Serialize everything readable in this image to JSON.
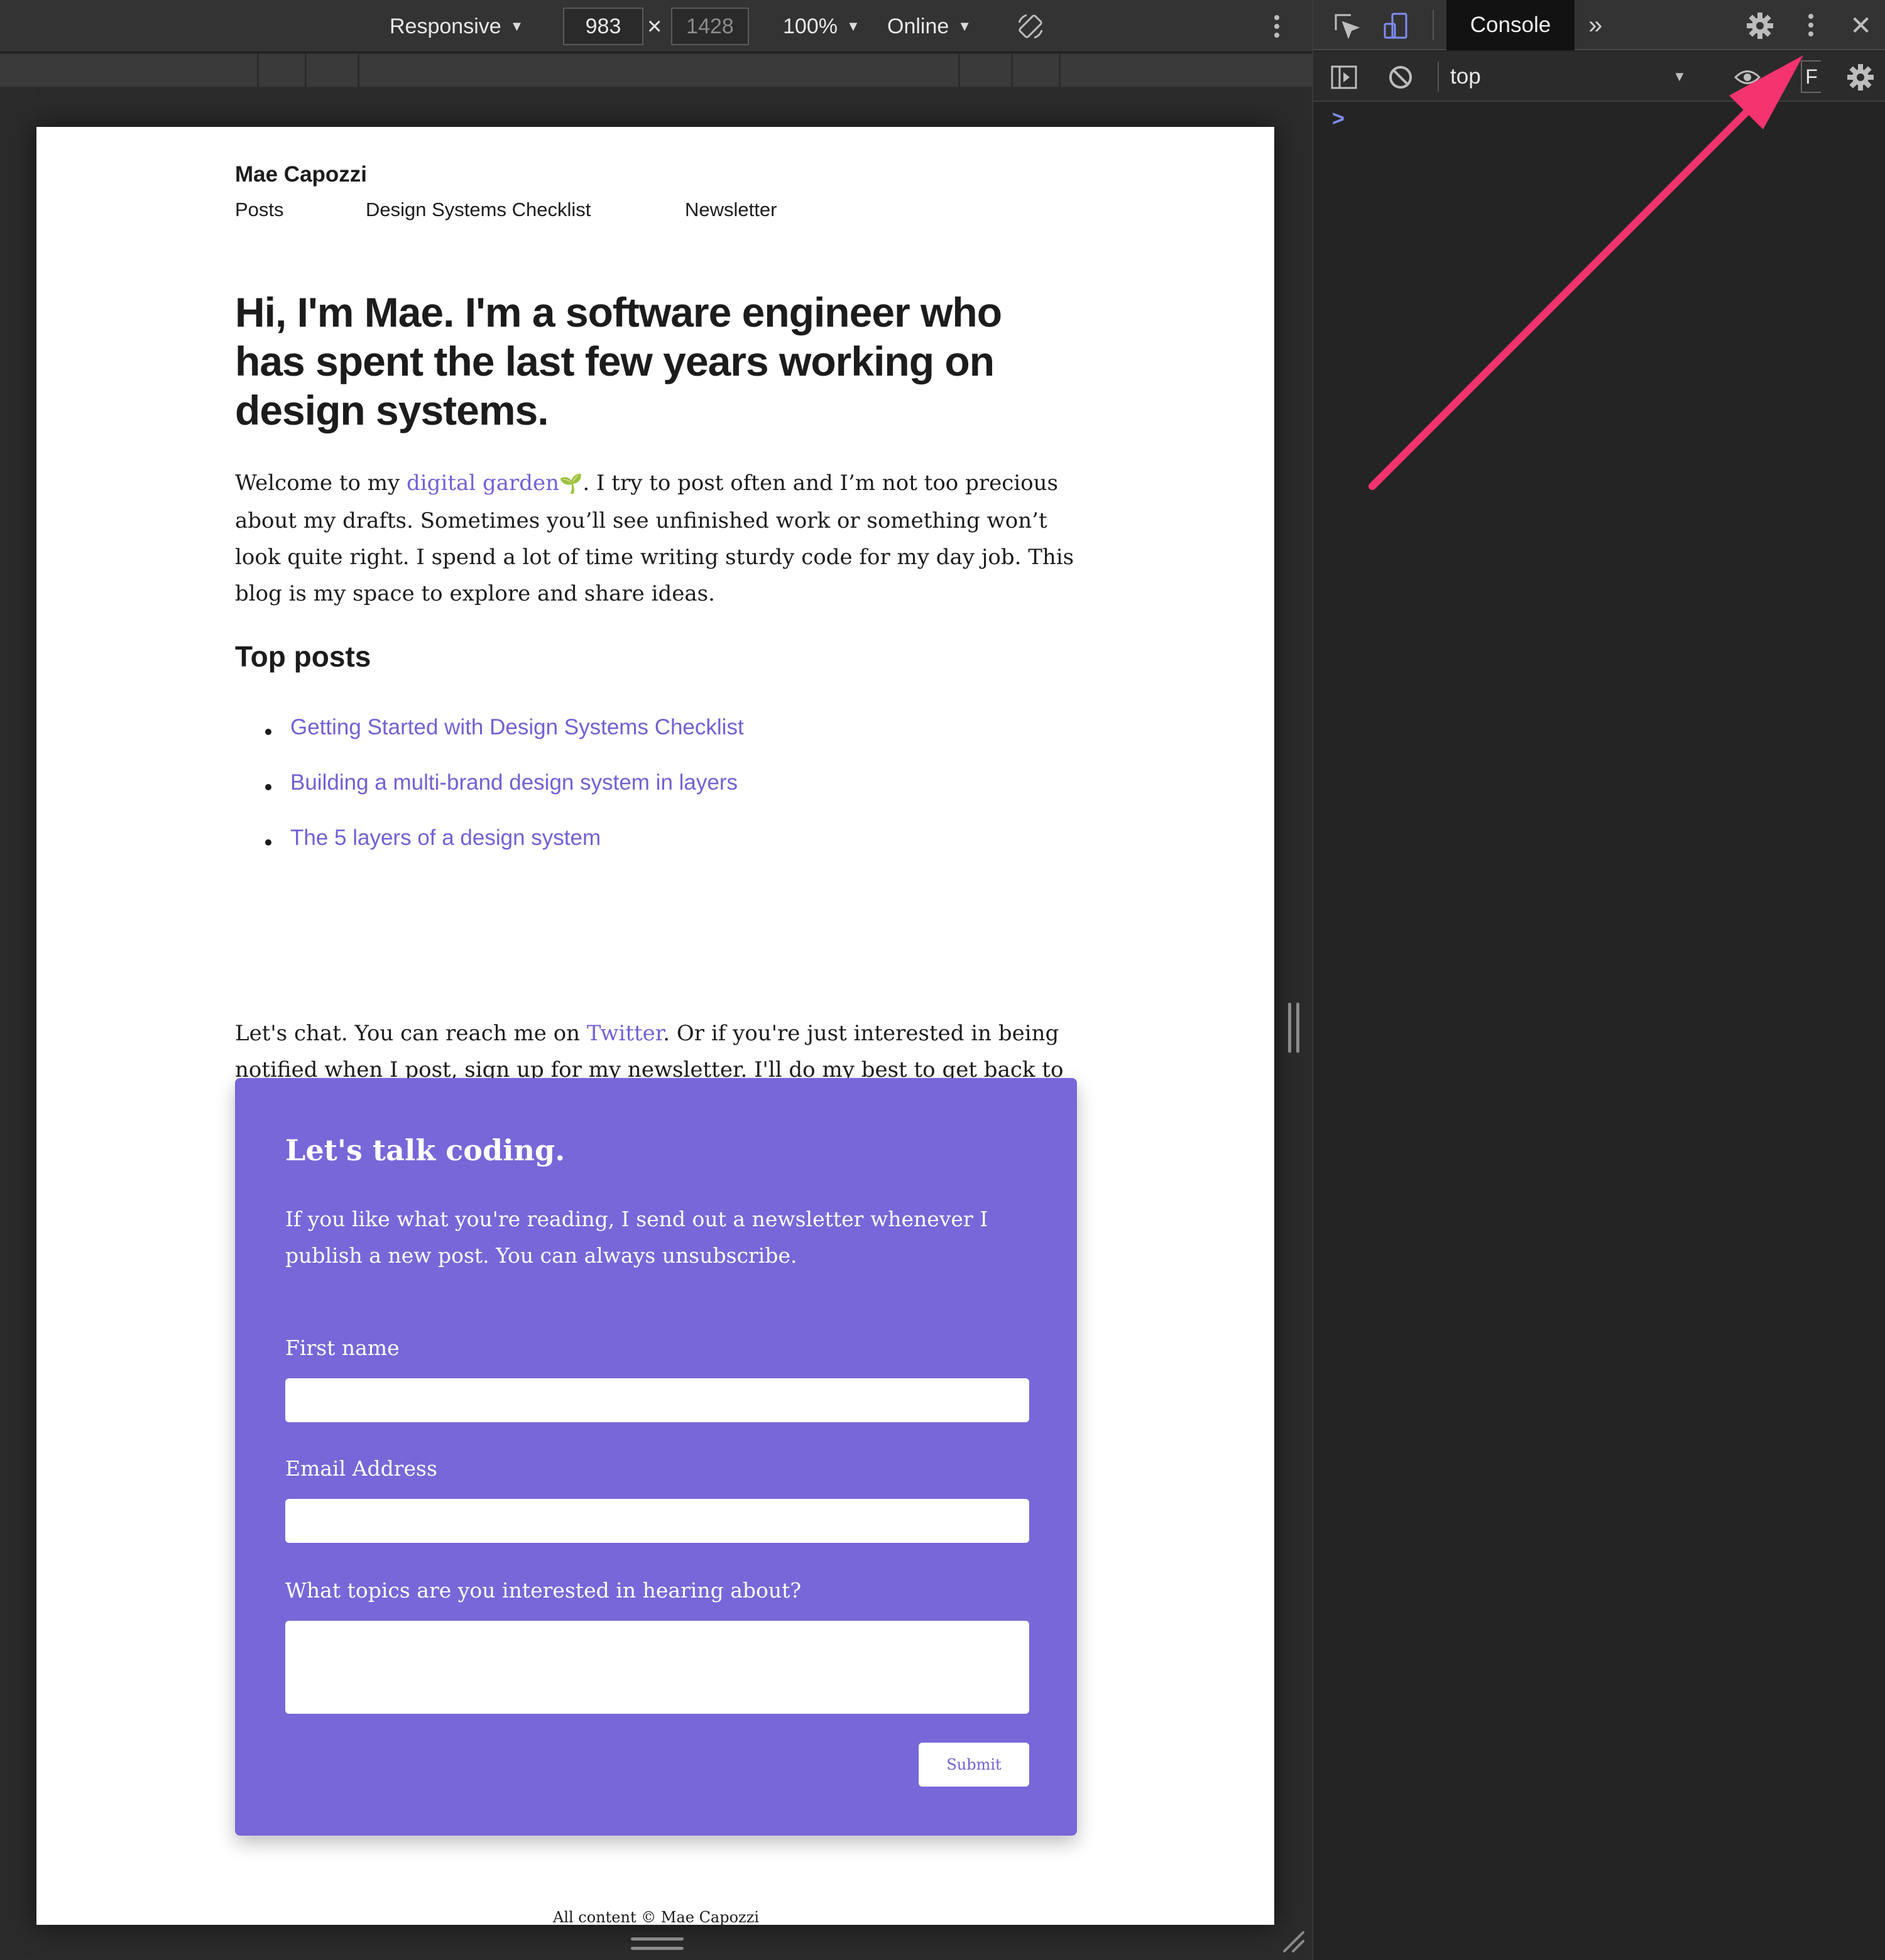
{
  "device_toolbar": {
    "mode": "Responsive",
    "width": "983",
    "height": "1428",
    "zoom": "100%",
    "throttling": "Online",
    "caret": "▼",
    "times": "×"
  },
  "site": {
    "name": "Mae Capozzi",
    "nav": [
      "Posts",
      "Design Systems Checklist",
      "Newsletter"
    ]
  },
  "hero": {
    "heading": "Hi, I'm Mae. I'm a software engineer who has spent the last few years working on design systems."
  },
  "intro": {
    "before": "Welcome to my ",
    "link": "digital garden",
    "sprout": "🌱",
    "after": ". I try to post often and I’m not too precious about my drafts. Sometimes you’ll see unfinished work or something won’t look quite right. I spend a lot of time writing sturdy code for my day job. This blog is my space to explore and share ideas."
  },
  "top_posts": {
    "title": "Top posts",
    "items": [
      "Getting Started with Design Systems Checklist",
      "Building a multi-brand design system in layers",
      "The 5 layers of a design system"
    ]
  },
  "chat": {
    "before": "Let's chat. You can reach me on ",
    "link": "Twitter",
    "after": ". Or if you're just interested in being notified when I post, sign up for my newsletter. I'll do my best to get back to you as soon as I can."
  },
  "newsletter": {
    "title": "Let's talk coding.",
    "description": "If you like what you're reading, I send out a newsletter whenever I publish a new post. You can always unsubscribe.",
    "first_name_label": "First name",
    "email_label": "Email Address",
    "topics_label": "What topics are you interested in hearing about?",
    "submit_label": "Submit",
    "background_color": "#7767d8"
  },
  "footer": {
    "text": "All content © Mae Capozzi"
  },
  "devtools": {
    "active_tab": "Console",
    "more_tabs": "»",
    "close": "✕",
    "context": "top",
    "filter_initial": "F",
    "prompt": ">"
  },
  "colors": {
    "link": "#7460d4",
    "devtools_bg": "#242424",
    "arrow": "#f5336e"
  }
}
